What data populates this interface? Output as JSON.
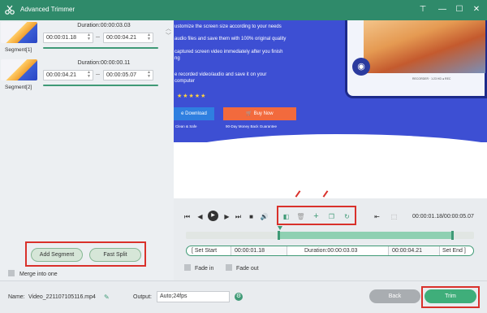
{
  "window": {
    "title": "Advanced Trimmer",
    "logo_icon": "trimmer-logo-icon",
    "controls": {
      "pin": "⊤",
      "minimize": "—",
      "restore": "☐",
      "close": "✕"
    }
  },
  "segments": [
    {
      "label": "Segment[1]",
      "duration": "Duration:00:00:03.03",
      "start": "00:00:01.18",
      "end": "00:00:04.21"
    },
    {
      "label": "Segment[2]",
      "duration": "Duration:00:00:00.11",
      "start": "00:00:04.21",
      "end": "00:00:05.07"
    }
  ],
  "segment_actions": {
    "add_segment": "Add Segment",
    "fast_split": "Fast Split"
  },
  "merge_label": "Merge into one",
  "preview": {
    "lines": [
      "ustomize the screen size according to your needs",
      "audio files and save them with 100% original quality",
      "captured screen video immediately after you finish",
      "ng",
      "e recorded video/audio and save it on your",
      "computer"
    ],
    "stars": "★★★★★",
    "download": "e Download",
    "buy_now": "Buy Now",
    "clean_safe": "Clean & Safe",
    "guarantee": "90-Day Money Back Guarantee",
    "mini": "RECORDER · 1:23 HD ● REC"
  },
  "player": {
    "timecode": "00:00:01.18/00:00:05.07"
  },
  "range": {
    "set_start": "Set Start",
    "start_value": "00:00:01.18",
    "duration": "Duration:00:00:03.03",
    "end_value": "00:00:04.21",
    "set_end": "Set End"
  },
  "fade": {
    "fade_in": "Fade in",
    "fade_out": "Fade out"
  },
  "footer": {
    "name_label": "Name:",
    "file_name": "Video_221107105116.mp4",
    "output_label": "Output:",
    "output_value": "Auto;24fps",
    "back": "Back",
    "trim": "Trim"
  },
  "colors": {
    "accent": "#3f9a76",
    "titlebar": "#2f8a6a",
    "highlight": "#d9312b"
  }
}
